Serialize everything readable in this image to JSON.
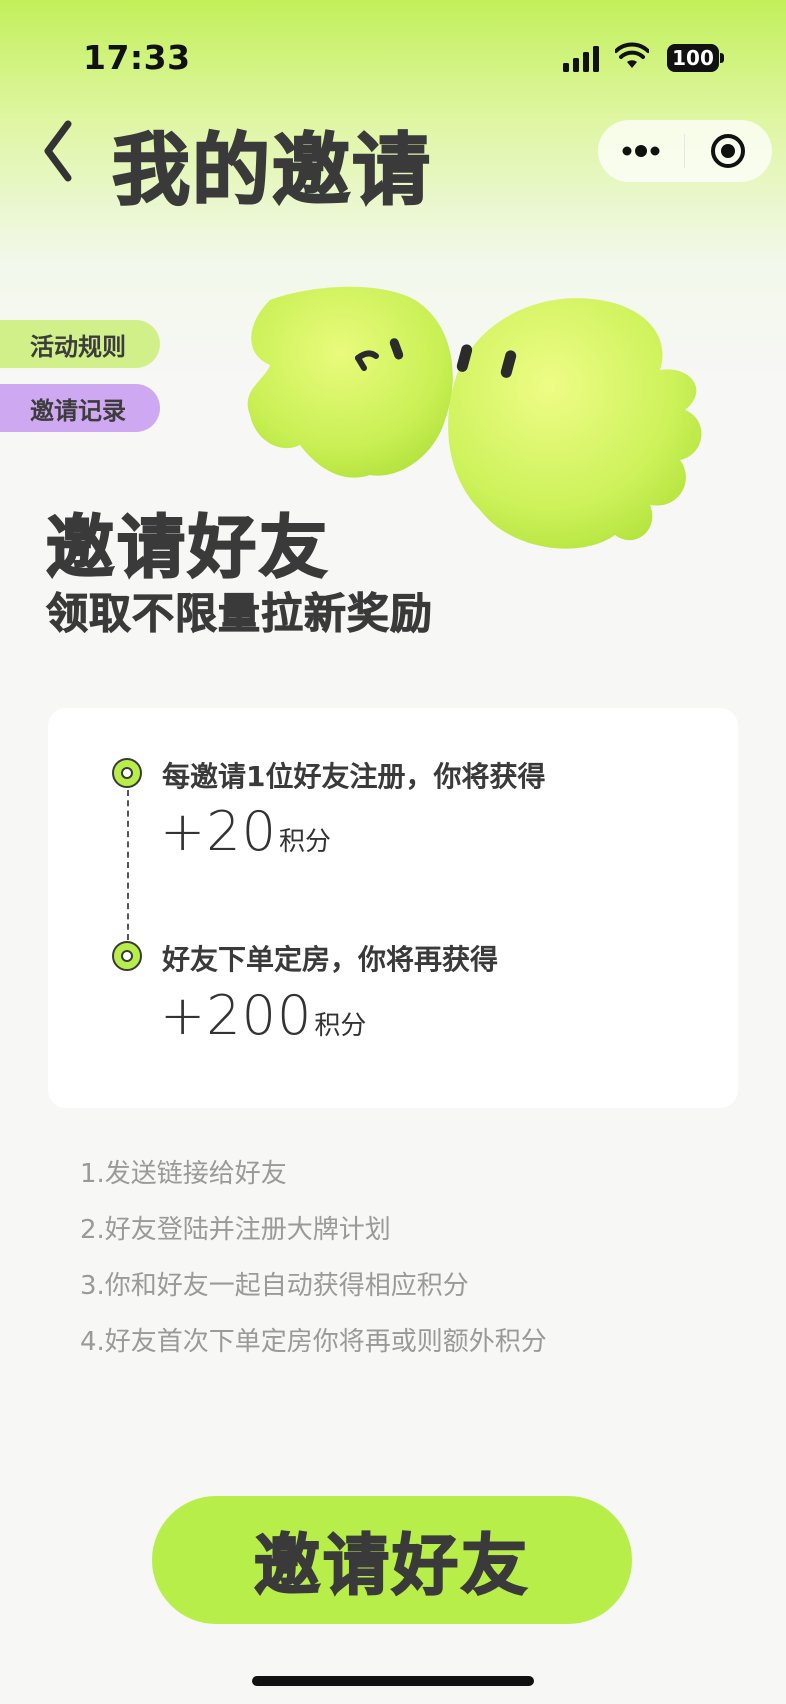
{
  "status_bar": {
    "time": "17:33",
    "battery": "100",
    "icons": [
      "signal-icon",
      "wifi-icon",
      "battery-icon"
    ]
  },
  "header": {
    "title": "我的邀请",
    "icons": [
      "back-icon",
      "more-icon",
      "close-mini-program-icon"
    ]
  },
  "side_tabs": {
    "rules": "活动规则",
    "records": "邀请记录"
  },
  "hero": {
    "title": "邀请好友",
    "subtitle": "领取不限量拉新奖励"
  },
  "rewards": [
    {
      "label": "每邀请1位好友注册，你将获得",
      "value": "+20",
      "unit": "积分"
    },
    {
      "label": "好友下单定房，你将再获得",
      "value": "+200",
      "unit": "积分"
    }
  ],
  "steps": [
    "1.发送链接给好友",
    "2.好友登陆并注册大牌计划",
    "3.你和好友一起自动获得相应积分",
    "4.好友首次下单定房你将再或则额外积分"
  ],
  "cta": {
    "label": "邀请好友"
  },
  "colors": {
    "accent": "#b8ee4a",
    "purple_tab": "#cfa8f2",
    "text_dark": "#3a3a3a",
    "step_gray": "#9a9a9a"
  }
}
